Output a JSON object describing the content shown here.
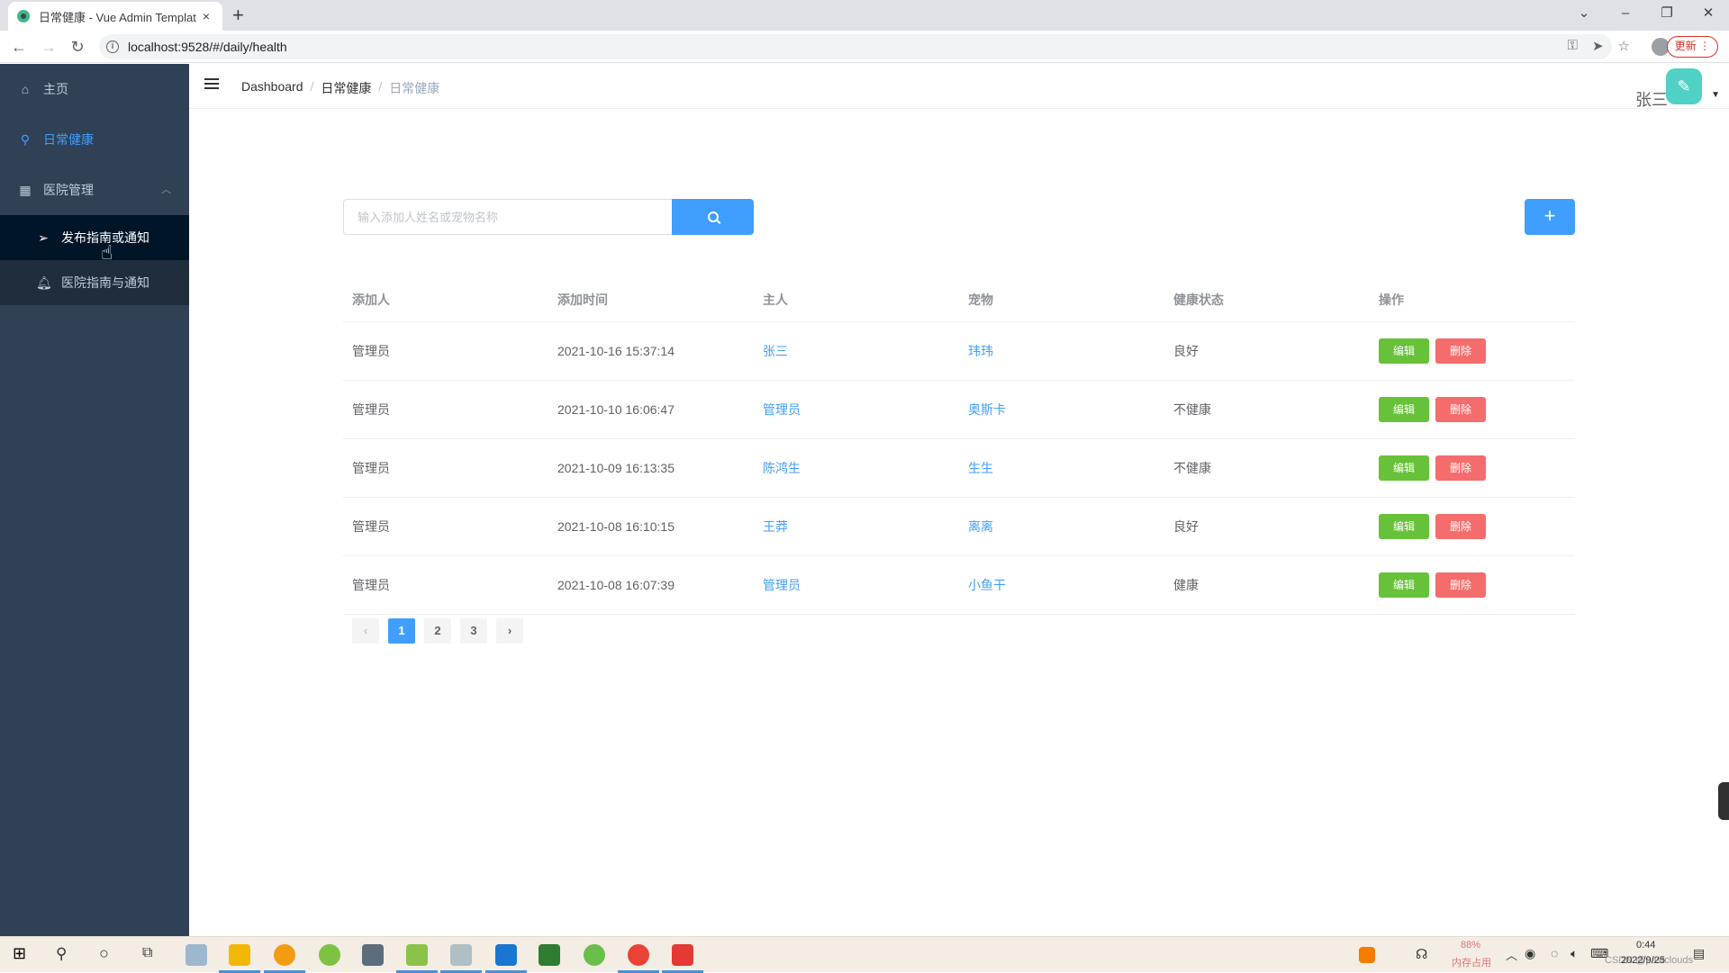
{
  "browser": {
    "tab_title": "日常健康 - Vue Admin Templat",
    "tab_close": "×",
    "new_tab": "+",
    "url": "localhost:9528/#/daily/health",
    "update_label": "更新 ⋮",
    "win_min": "–",
    "win_max": "❐",
    "win_close": "✕",
    "tab_search": "⌄"
  },
  "sidebar": {
    "items": [
      {
        "label": "主页",
        "icon": "home-icon"
      },
      {
        "label": "日常健康",
        "icon": "health-icon",
        "active": true
      },
      {
        "label": "医院管理",
        "icon": "hospital-icon",
        "expanded": true
      }
    ],
    "subitems": [
      {
        "label": "发布指南或通知",
        "icon": "send-icon"
      },
      {
        "label": "医院指南与通知",
        "icon": "bell-icon"
      }
    ]
  },
  "navbar": {
    "breadcrumb": [
      "Dashboard",
      "日常健康",
      "日常健康"
    ],
    "separator": "/",
    "user_name": "张三"
  },
  "search": {
    "placeholder": "输入添加人姓名或宠物名称",
    "add_label": "+"
  },
  "table": {
    "headers": [
      "添加人",
      "添加时间",
      "主人",
      "宠物",
      "健康状态",
      "操作"
    ],
    "rows": [
      {
        "adder": "管理员",
        "time": "2021-10-16 15:37:14",
        "owner": "张三",
        "pet": "玮玮",
        "status": "良好"
      },
      {
        "adder": "管理员",
        "time": "2021-10-10 16:06:47",
        "owner": "管理员",
        "pet": "奥斯卡",
        "status": "不健康"
      },
      {
        "adder": "管理员",
        "time": "2021-10-09 16:13:35",
        "owner": "陈鸿生",
        "pet": "生生",
        "status": "不健康"
      },
      {
        "adder": "管理员",
        "time": "2021-10-08 16:10:15",
        "owner": "王莽",
        "pet": "离离",
        "status": "良好"
      },
      {
        "adder": "管理员",
        "time": "2021-10-08 16:07:39",
        "owner": "管理员",
        "pet": "小鱼干",
        "status": "健康"
      }
    ],
    "edit_label": "编辑",
    "delete_label": "删除"
  },
  "pagination": {
    "prev": "‹",
    "pages": [
      "1",
      "2",
      "3"
    ],
    "current": "1",
    "next": "›"
  },
  "taskbar": {
    "mem_percent": "88%",
    "mem_label": "内存占用",
    "time": "0:44",
    "date": "2022/9/25",
    "watermark": "CSDN @pastclouds"
  },
  "colors": {
    "sidebar_bg": "#304156",
    "accent": "#409eff",
    "edit": "#67c23a",
    "delete": "#f56c6c"
  }
}
